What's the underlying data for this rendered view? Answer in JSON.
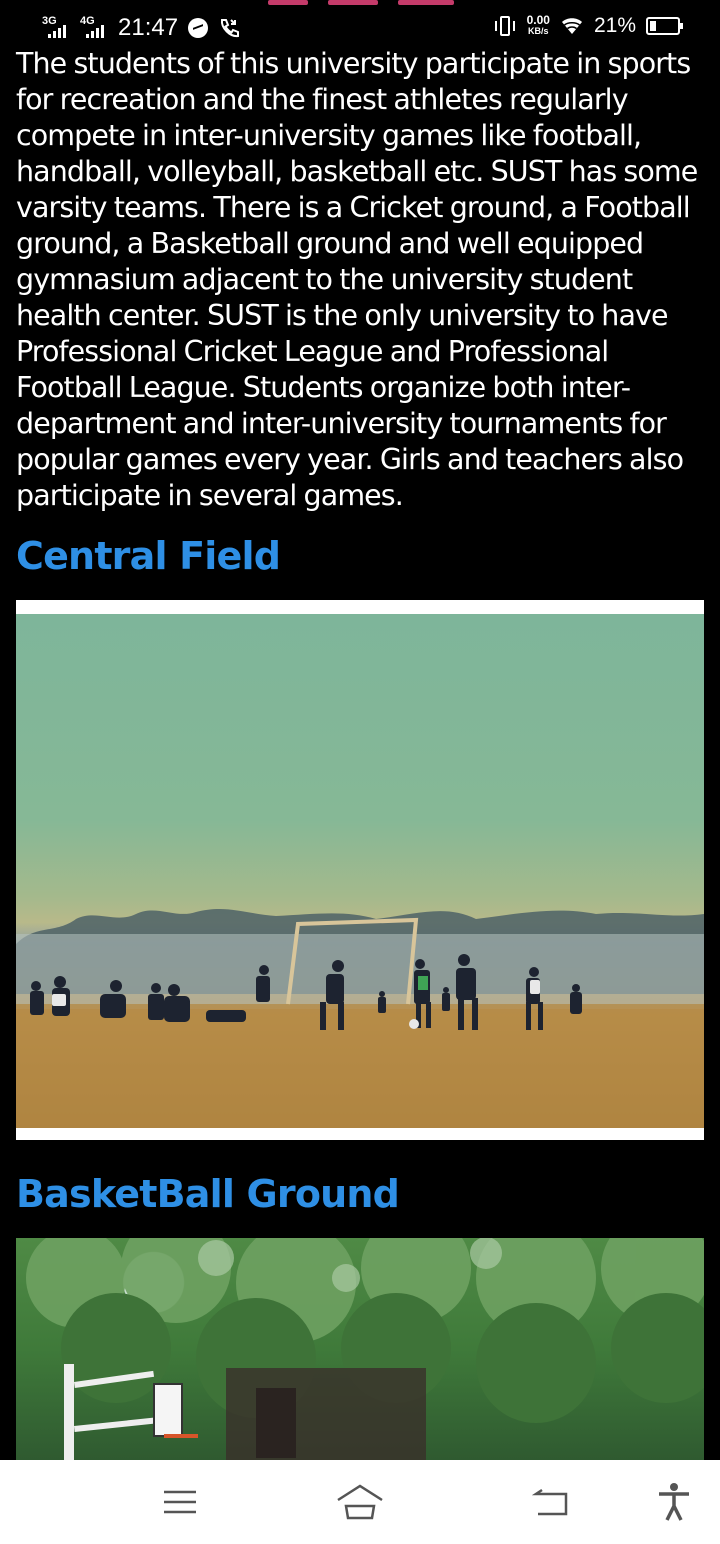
{
  "status_bar": {
    "network1": "3G",
    "network2": "4G",
    "time": "21:47",
    "speed_value": "0.00",
    "speed_unit": "KB/s",
    "battery": "21%"
  },
  "article": {
    "paragraph": "The students of this university participate in sports for recreation and the finest athletes regularly compete in inter-university games like football, handball, volleyball, basketball etc. SUST has some varsity teams. There is a Cricket ground, a Football ground, a Basketball ground and well equipped gymnasium adjacent to the university student health center. SUST is the only university to have Professional Cricket League and Professional Football League. Students organize both inter-department and inter-university tournaments for popular games every year. Girls and teachers also participate in several games.",
    "sections": [
      {
        "title": "Central Field"
      },
      {
        "title": "BasketBall Ground"
      }
    ]
  },
  "nav_bar": {
    "icons": [
      "menu-icon",
      "home-icon",
      "back-icon",
      "accessibility-icon"
    ]
  },
  "colors": {
    "background": "#000000",
    "heading": "#2e8fe5",
    "text": "#ffffff",
    "nav_background": "#ffffff",
    "nav_icon": "#555555"
  }
}
